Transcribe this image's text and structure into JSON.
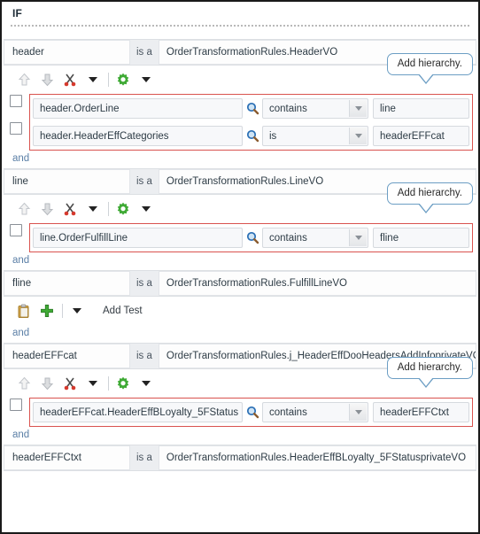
{
  "panel": {
    "title": "IF"
  },
  "labels": {
    "is_a": "is a",
    "and": "and",
    "add_test": "Add Test",
    "tooltip_add_hierarchy": "Add hierarchy."
  },
  "icons": {
    "move_up": "arrow-up-icon",
    "move_down": "arrow-down-icon",
    "cut": "scissors-icon",
    "caret": "caret-down-icon",
    "settings": "gear-icon",
    "paste": "clipboard-icon",
    "add": "plus-icon",
    "search": "magnifier-icon",
    "checkbox": "checkbox-icon"
  },
  "colors": {
    "condition_border": "#d9534f",
    "tooltip_border": "#6c9ec4",
    "gear_green": "#3faa35",
    "plus_green": "#3faa35",
    "scissors_red": "#d63a2e",
    "and_text": "#5b7fa6",
    "frame": "#1a1a1a"
  },
  "sections": [
    {
      "id": "header",
      "declaration": {
        "variable": "header",
        "type": "OrderTransformationRules.HeaderVO"
      },
      "toolbar": [
        "move-up",
        "move-down",
        "cut",
        "caret",
        "gear",
        "caret"
      ],
      "tooltip": "Add hierarchy.",
      "conditions": [
        {
          "checked": false,
          "left": "header.OrderLine",
          "operator": "contains",
          "right": "line"
        },
        {
          "checked": false,
          "left": "header.HeaderEffCategories",
          "operator": "is",
          "right": "headerEFFcat"
        }
      ],
      "connector": "and"
    },
    {
      "id": "line",
      "declaration": {
        "variable": "line",
        "type": "OrderTransformationRules.LineVO"
      },
      "toolbar": [
        "move-up",
        "move-down",
        "cut",
        "caret",
        "gear",
        "caret"
      ],
      "tooltip": "Add hierarchy.",
      "conditions": [
        {
          "checked": false,
          "left": "line.OrderFulfillLine",
          "operator": "contains",
          "right": "fline"
        }
      ],
      "connector": "and"
    },
    {
      "id": "fline",
      "declaration": {
        "variable": "fline",
        "type": "OrderTransformationRules.FulfillLineVO"
      },
      "addtest_toolbar": [
        "paste",
        "plus",
        "caret"
      ],
      "addtest_label": "Add Test",
      "connector": "and"
    },
    {
      "id": "headerEFFcat",
      "declaration": {
        "variable": "headerEFFcat",
        "type": "OrderTransformationRules.j_HeaderEffDooHeadersAddInfoprivateVO"
      },
      "toolbar": [
        "move-up",
        "move-down",
        "cut",
        "caret",
        "gear",
        "caret"
      ],
      "tooltip": "Add hierarchy.",
      "conditions": [
        {
          "checked": false,
          "left": "headerEFFcat.HeaderEffBLoyalty_5FStatus",
          "operator": "contains",
          "right": "headerEFFCtxt"
        }
      ],
      "connector": "and"
    },
    {
      "id": "headerEFFCtxt",
      "declaration": {
        "variable": "headerEFFCtxt",
        "type": "OrderTransformationRules.HeaderEffBLoyalty_5FStatusprivateVO"
      }
    }
  ]
}
